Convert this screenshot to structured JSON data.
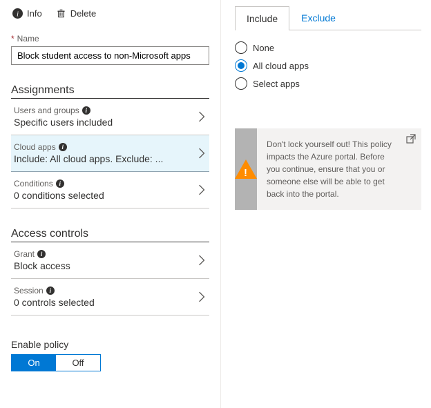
{
  "toolbar": {
    "info": "Info",
    "delete": "Delete"
  },
  "name": {
    "label": "Name",
    "value": "Block student access to non-Microsoft apps"
  },
  "sections": {
    "assignments": "Assignments",
    "access": "Access controls"
  },
  "items": {
    "users": {
      "title": "Users and groups",
      "value": "Specific users included"
    },
    "apps": {
      "title": "Cloud apps",
      "value": "Include: All cloud apps. Exclude: ..."
    },
    "cond": {
      "title": "Conditions",
      "value": "0 conditions selected"
    },
    "grant": {
      "title": "Grant",
      "value": "Block access"
    },
    "session": {
      "title": "Session",
      "value": "0 controls selected"
    }
  },
  "enable": {
    "label": "Enable policy",
    "on": "On",
    "off": "Off"
  },
  "tabs": {
    "include": "Include",
    "exclude": "Exclude"
  },
  "radios": {
    "none": "None",
    "all": "All cloud apps",
    "select": "Select apps"
  },
  "warn": "Don't lock yourself out! This policy impacts the Azure portal. Before you continue, ensure that you or someone else will be able to get back into the portal."
}
